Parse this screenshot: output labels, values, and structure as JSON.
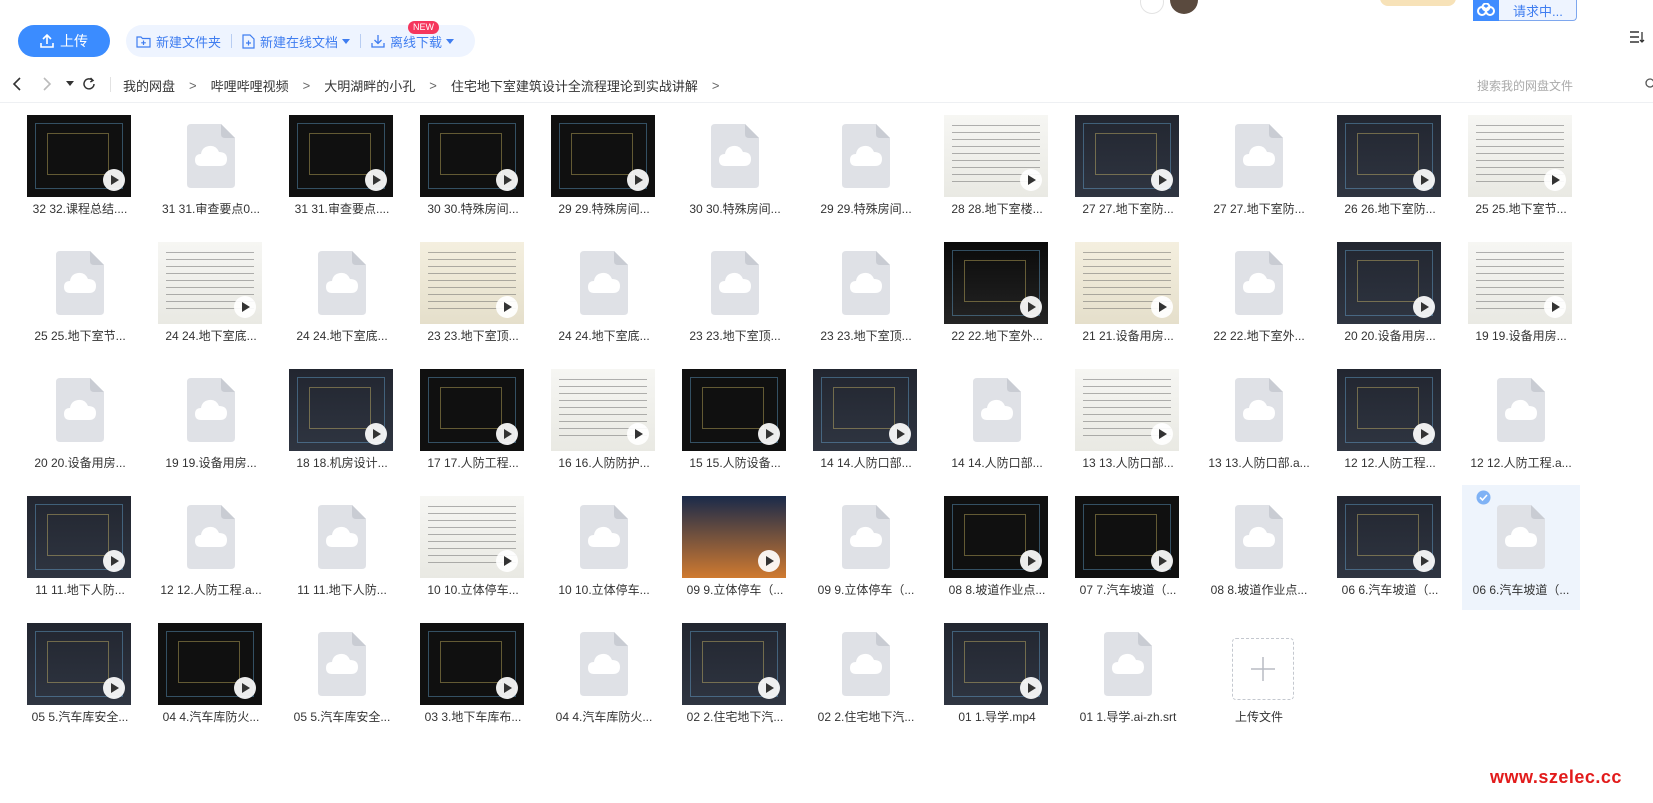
{
  "header": {
    "request_label": "请求中..."
  },
  "toolbar": {
    "upload_label": "上传",
    "new_folder_label": "新建文件夹",
    "new_doc_label": "新建在线文档",
    "new_badge": "NEW",
    "offline_download_label": "离线下载"
  },
  "breadcrumb": [
    "我的网盘",
    "哔哩哔哩视频",
    "大明湖畔的小孔",
    "住宅地下室建筑设计全流程理论到实战讲解"
  ],
  "breadcrumb_separator": ">",
  "search": {
    "placeholder": "搜索我的网盘文件"
  },
  "files": [
    {
      "name": "32 32.课程总结....",
      "type": "video",
      "style": "v-cad"
    },
    {
      "name": "31 31.审查要点0...",
      "type": "file"
    },
    {
      "name": "31 31.审查要点....",
      "type": "video",
      "style": "v-cad"
    },
    {
      "name": "30 30.特殊房间...",
      "type": "video",
      "style": "v-cad"
    },
    {
      "name": "29 29.特殊房间...",
      "type": "video",
      "style": "v-cad"
    },
    {
      "name": "30 30.特殊房间...",
      "type": "file"
    },
    {
      "name": "29 29.特殊房间...",
      "type": "file"
    },
    {
      "name": "28 28.地下室楼...",
      "type": "video",
      "style": "v-doc"
    },
    {
      "name": "27 27.地下室防...",
      "type": "video",
      "style": "v-mid"
    },
    {
      "name": "27 27.地下室防...",
      "type": "file"
    },
    {
      "name": "26 26.地下室防...",
      "type": "video",
      "style": "v-mid"
    },
    {
      "name": "25 25.地下室节...",
      "type": "video",
      "style": "v-doc"
    },
    {
      "name": "25 25.地下室节...",
      "type": "file"
    },
    {
      "name": "24 24.地下室底...",
      "type": "video",
      "style": "v-doc"
    },
    {
      "name": "24 24.地下室底...",
      "type": "file"
    },
    {
      "name": "23 23.地下室顶...",
      "type": "video",
      "style": "v-warm"
    },
    {
      "name": "24 24.地下室底...",
      "type": "file"
    },
    {
      "name": "23 23.地下室顶...",
      "type": "file"
    },
    {
      "name": "23 23.地下室顶...",
      "type": "file"
    },
    {
      "name": "22 22.地下室外...",
      "type": "video",
      "style": "v-dark"
    },
    {
      "name": "21 21.设备用房...",
      "type": "video",
      "style": "v-warm"
    },
    {
      "name": "22 22.地下室外...",
      "type": "file"
    },
    {
      "name": "20 20.设备用房...",
      "type": "video",
      "style": "v-mid"
    },
    {
      "name": "19 19.设备用房...",
      "type": "video",
      "style": "v-doc"
    },
    {
      "name": "20 20.设备用房...",
      "type": "file"
    },
    {
      "name": "19 19.设备用房...",
      "type": "file"
    },
    {
      "name": "18 18.机房设计...",
      "type": "video",
      "style": "v-mid"
    },
    {
      "name": "17 17.人防工程...",
      "type": "video",
      "style": "v-cad"
    },
    {
      "name": "16 16.人防防护...",
      "type": "video",
      "style": "v-doc"
    },
    {
      "name": "15 15.人防设备...",
      "type": "video",
      "style": "v-cad"
    },
    {
      "name": "14 14.人防口部...",
      "type": "video",
      "style": "v-mid"
    },
    {
      "name": "14 14.人防口部...",
      "type": "file"
    },
    {
      "name": "13 13.人防口部...",
      "type": "video",
      "style": "v-doc"
    },
    {
      "name": "13 13.人防口部.a...",
      "type": "file"
    },
    {
      "name": "12 12.人防工程...",
      "type": "video",
      "style": "v-mid"
    },
    {
      "name": "12 12.人防工程.a...",
      "type": "file"
    },
    {
      "name": "11 11.地下人防...",
      "type": "video",
      "style": "v-mid"
    },
    {
      "name": "12 12.人防工程.a...",
      "type": "file"
    },
    {
      "name": "11 11.地下人防...",
      "type": "file"
    },
    {
      "name": "10 10.立体停车...",
      "type": "video",
      "style": "v-doc"
    },
    {
      "name": "10 10.立体停车...",
      "type": "file"
    },
    {
      "name": "09 9.立体停车（...",
      "type": "video",
      "style": "v-night"
    },
    {
      "name": "09 9.立体停车（...",
      "type": "file"
    },
    {
      "name": "08 8.坡道作业点...",
      "type": "video",
      "style": "v-cad"
    },
    {
      "name": "07 7.汽车坡道（...",
      "type": "video",
      "style": "v-cad"
    },
    {
      "name": "08 8.坡道作业点...",
      "type": "file"
    },
    {
      "name": "06 6.汽车坡道（...",
      "type": "video",
      "style": "v-mid"
    },
    {
      "name": "06 6.汽车坡道（...",
      "type": "file",
      "selected": true
    },
    {
      "name": "05 5.汽车库安全...",
      "type": "video",
      "style": "v-mid"
    },
    {
      "name": "04 4.汽车库防火...",
      "type": "video",
      "style": "v-cad"
    },
    {
      "name": "05 5.汽车库安全...",
      "type": "file"
    },
    {
      "name": "03 3.地下车库布...",
      "type": "video",
      "style": "v-cad"
    },
    {
      "name": "04 4.汽车库防火...",
      "type": "file"
    },
    {
      "name": "02 2.住宅地下汽...",
      "type": "video",
      "style": "v-mid"
    },
    {
      "name": "02 2.住宅地下汽...",
      "type": "file"
    },
    {
      "name": "01 1.导学.mp4",
      "type": "video",
      "style": "v-mid"
    },
    {
      "name": "01 1.导学.ai-zh.srt",
      "type": "file"
    },
    {
      "name": "上传文件",
      "type": "upload"
    }
  ],
  "watermark": "www.szelec.cc",
  "colors": {
    "accent": "#3b8cff",
    "watermark": "#e21b1b",
    "selection": "#eef4fc"
  }
}
